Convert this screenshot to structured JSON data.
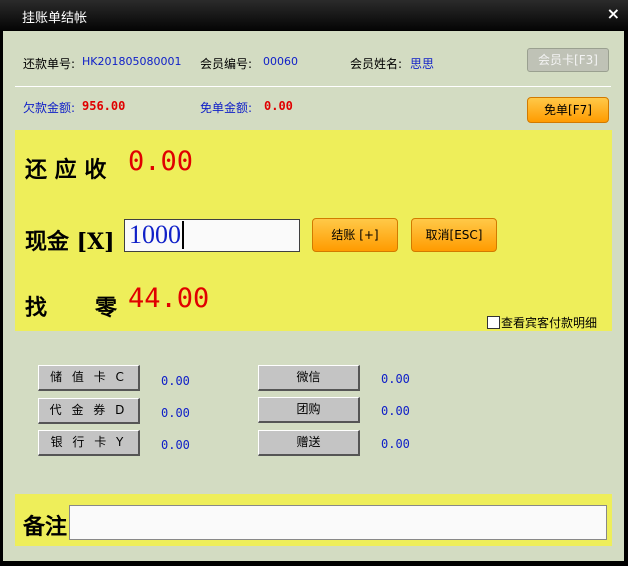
{
  "window": {
    "title": "挂账单结帐",
    "close_glyph": "×"
  },
  "info": {
    "bill_no_label": "还款单号:",
    "bill_no": "HK201805080001",
    "member_no_label": "会员编号:",
    "member_no": "00060",
    "member_name_label": "会员姓名:",
    "member_name": "思思",
    "member_card_button": "会员卡[F3]",
    "owed_label": "欠款金额:",
    "owed_value": "956.00",
    "waive_label": "免单金额:",
    "waive_value": "0.00",
    "waive_button": "免单[F7]"
  },
  "payment": {
    "due_label": "还 应 收",
    "due_value": "0.00",
    "cash_label": "现金 [X]",
    "cash_value": "1000",
    "checkout_button": "结账 [+]",
    "cancel_button": "取消[ESC]",
    "change_label_1": "找",
    "change_label_2": "零",
    "change_value": "44.00",
    "detail_checkbox_label": "查看宾客付款明细",
    "detail_checked": false
  },
  "methods_left": [
    {
      "label": "储值卡C",
      "display": "储 值 卡 C",
      "value": "0.00"
    },
    {
      "label": "代金券D",
      "display": "代 金 券 D",
      "value": "0.00"
    },
    {
      "label": "银行卡Y",
      "display": "银 行 卡 Y",
      "value": "0.00"
    }
  ],
  "methods_right": [
    {
      "label": "微信",
      "value": "0.00"
    },
    {
      "label": "团购",
      "value": "0.00"
    },
    {
      "label": "赠送",
      "value": "0.00"
    }
  ],
  "remark": {
    "label": "备注",
    "value": ""
  }
}
